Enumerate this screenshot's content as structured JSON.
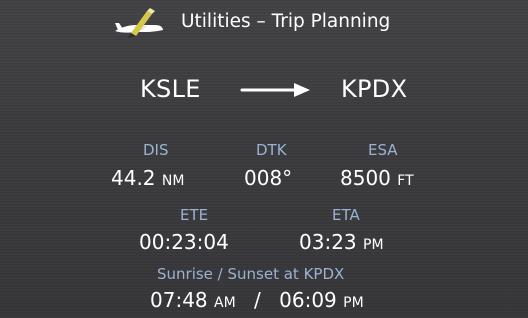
{
  "header": {
    "title": "Utilities – Trip Planning",
    "icon": "airplane-pencil-icon"
  },
  "route": {
    "from": "KSLE",
    "to": "KPDX",
    "arrow_icon": "right-arrow-icon"
  },
  "metrics": {
    "dis": {
      "label": "DIS",
      "value": "44.2",
      "unit": "NM"
    },
    "dtk": {
      "label": "DTK",
      "value": "008°"
    },
    "esa": {
      "label": "ESA",
      "value": "8500",
      "unit": "FT"
    },
    "ete": {
      "label": "ETE",
      "value": "00:23:04"
    },
    "eta": {
      "label": "ETA",
      "value": "03:23",
      "suffix": "PM"
    }
  },
  "sun": {
    "label": "Sunrise / Sunset at KPDX",
    "sunrise": {
      "value": "07:48",
      "suffix": "AM"
    },
    "separator": "/",
    "sunset": {
      "value": "06:09",
      "suffix": "PM"
    }
  },
  "colors": {
    "background": "#3c3b3e",
    "label": "#9bb2d5",
    "value": "#ffffff",
    "icon_accent": "#d4c84a"
  }
}
